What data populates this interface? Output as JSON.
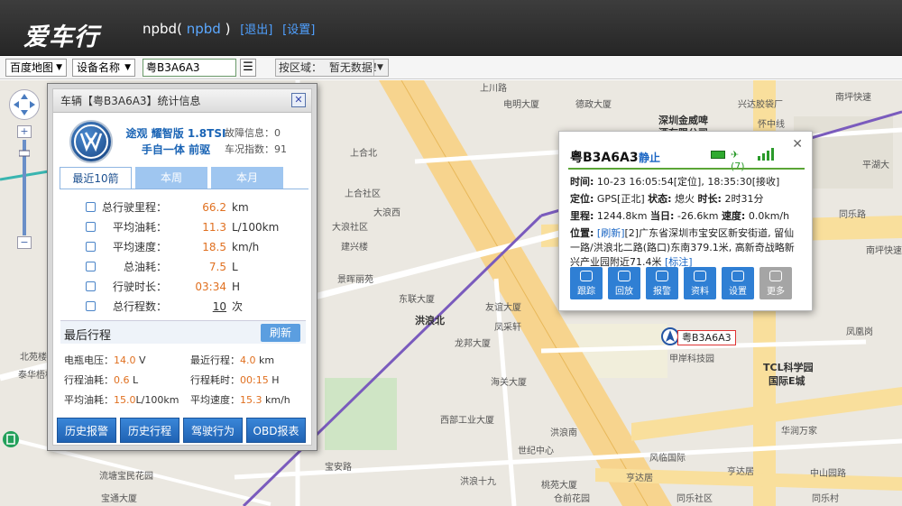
{
  "header": {
    "logo_text": "爱车行",
    "username": "npbd(",
    "user_alias": "npbd",
    "user_suffix": ")",
    "logout_link": "[退出]",
    "settings_link": "[设置]"
  },
  "toolbar": {
    "map_select": "百度地图",
    "field_select": "设备名称",
    "search_value": "粤B3A6A3",
    "list_icon": "list-icon",
    "region_label": "按区域：",
    "region_value": "暂无数据！"
  },
  "map": {
    "labels": [
      "上川路",
      "电明大厦",
      "德政大厦",
      "兴达胶袋厂",
      "深圳金威啤",
      "酒有限公司",
      "怀中线",
      "南坪快速",
      "平湖大",
      "上合北",
      "上合社区",
      "大浪西",
      "大浪社区",
      "建兴楼",
      "景晖丽苑",
      "东联大厦",
      "友谊大厦",
      "洪浪北",
      "凤采轩",
      "龙邦大厦",
      "海关大厦",
      "西部工业大厦",
      "洪浪南",
      "世纪中心",
      "流塘宝民花园",
      "宝通大厦",
      "洪浪十九",
      "甲岸科技园",
      "TCL科学园",
      "国际E城",
      "华润万家",
      "中山园路",
      "南坪快速",
      "同乐路",
      "凤凰岗",
      "北苑楼",
      "泰华梧桐岛",
      "宝安路",
      "桃苑大厦",
      "亨达居",
      "同乐社区",
      "风临国际",
      "仓前花园",
      "亨达居",
      "同乐村"
    ]
  },
  "vehicle_panel": {
    "title": "车辆【粤B3A6A3】统计信息",
    "close_icon": "close-icon",
    "brand_logo": "volkswagen-logo",
    "model_line1": "途观 耀智版 1.8TSI",
    "model_line2": "手自一体 前驱",
    "fault_info": "故障信息：0",
    "car_index": "车况指数：91",
    "tabs": [
      "最近10箭",
      "本周",
      "本月"
    ],
    "stats": [
      {
        "label": "总行驶里程：",
        "value": "66.2",
        "unit": "km"
      },
      {
        "label": "平均油耗：",
        "value": "11.3",
        "unit": "L/100km"
      },
      {
        "label": "平均速度：",
        "value": "18.5",
        "unit": "km/h"
      },
      {
        "label": "总油耗：",
        "value": "7.5",
        "unit": "L"
      },
      {
        "label": "行驶时长：",
        "value": "03:34",
        "unit": "H"
      },
      {
        "label": "总行程数：",
        "value": "10",
        "unit": "次"
      }
    ],
    "last_trip_title": "最后行程",
    "refresh_label": "刷新",
    "last_trip": [
      {
        "l1": "电瓶电压：",
        "v1": "14.0",
        "u1": "V",
        "l2": "最近行程：",
        "v2": "4.0",
        "u2": "km"
      },
      {
        "l1": "行程油耗：",
        "v1": "0.6",
        "u1": "L",
        "l2": "行程耗时：",
        "v2": "00:15",
        "u2": "H"
      },
      {
        "l1": "平均油耗：",
        "v1": "15.0",
        "u1": "L/100km",
        "l2": "平均速度：",
        "v2": "15.3",
        "u2": "km/h"
      }
    ],
    "buttons": [
      "历史报警",
      "历史行程",
      "驾驶行为",
      "OBD报表"
    ]
  },
  "popup": {
    "plate": "粤B3A6A3",
    "state": "静止",
    "satellites": "(7)",
    "time_label": "时间:",
    "time_value": "10-23 16:05:54[定位], 18:35:30[接收]",
    "position_label": "定位:",
    "position_value": "GPS[正北]",
    "status_label": "状态:",
    "status_value": "熄火",
    "duration_label": "时长:",
    "duration_value": "2时31分",
    "mileage_label": "里程:",
    "mileage_value": "1244.8km",
    "today_label": "当日:",
    "today_value": "-26.6km",
    "speed_label": "速度:",
    "speed_value": "0.0km/h",
    "location_label": "位置:",
    "refresh_link": "[刷新]",
    "address": "[2]广东省深圳市宝安区新安街道, 留仙一路/洪浪北二路(路口)东南379.1米, 高新奇战略新兴产业园附近71.4米",
    "mark_link": "[标注]",
    "buttons": [
      "跟踪",
      "回放",
      "报警",
      "资料",
      "设置",
      "更多"
    ]
  },
  "marker": {
    "label": "粤B3A6A3"
  }
}
